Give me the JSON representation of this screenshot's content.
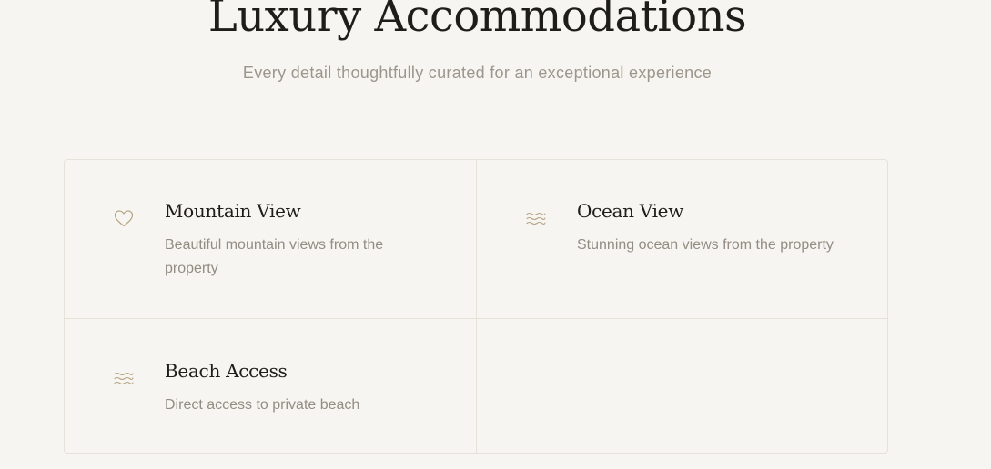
{
  "section": {
    "title": "Luxury Accommodations",
    "subtitle": "Every detail thoughtfully curated for an exceptional experience"
  },
  "features": [
    {
      "icon": "heart-icon",
      "title": "Mountain View",
      "description": "Beautiful mountain views from the property"
    },
    {
      "icon": "waves-icon",
      "title": "Ocean View",
      "description": "Stunning ocean views from the property"
    },
    {
      "icon": "waves-icon",
      "title": "Beach Access",
      "description": "Direct access to private beach"
    }
  ],
  "colors": {
    "background": "#f7f5f1",
    "accent": "#b7a484",
    "heading": "#1f1d1a",
    "body_text": "#938d83",
    "border": "#e6e2da"
  }
}
